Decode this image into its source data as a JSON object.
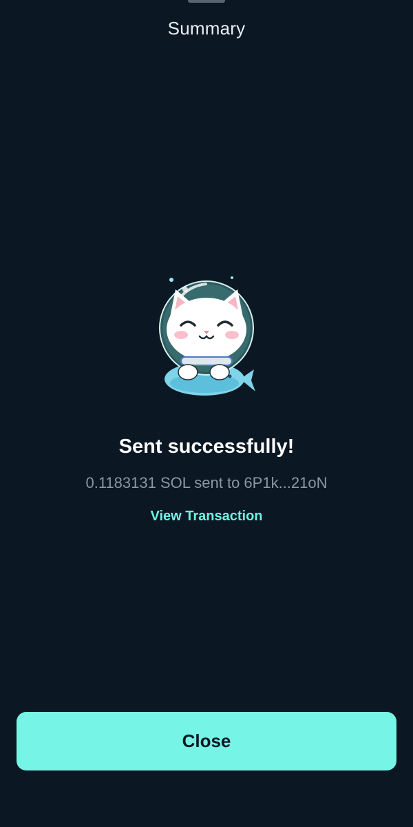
{
  "header": {
    "title": "Summary"
  },
  "status": {
    "headline": "Sent successfully!",
    "detail": "0.1183131 SOL sent to 6P1k...21oN",
    "link_label": "View Transaction"
  },
  "illustration": {
    "name": "astronaut-cat-mascot"
  },
  "footer": {
    "close_label": "Close"
  },
  "colors": {
    "background": "#0b1722",
    "accent": "#76f5e6",
    "link": "#6ff3e3",
    "muted_text": "#8c97a1"
  }
}
